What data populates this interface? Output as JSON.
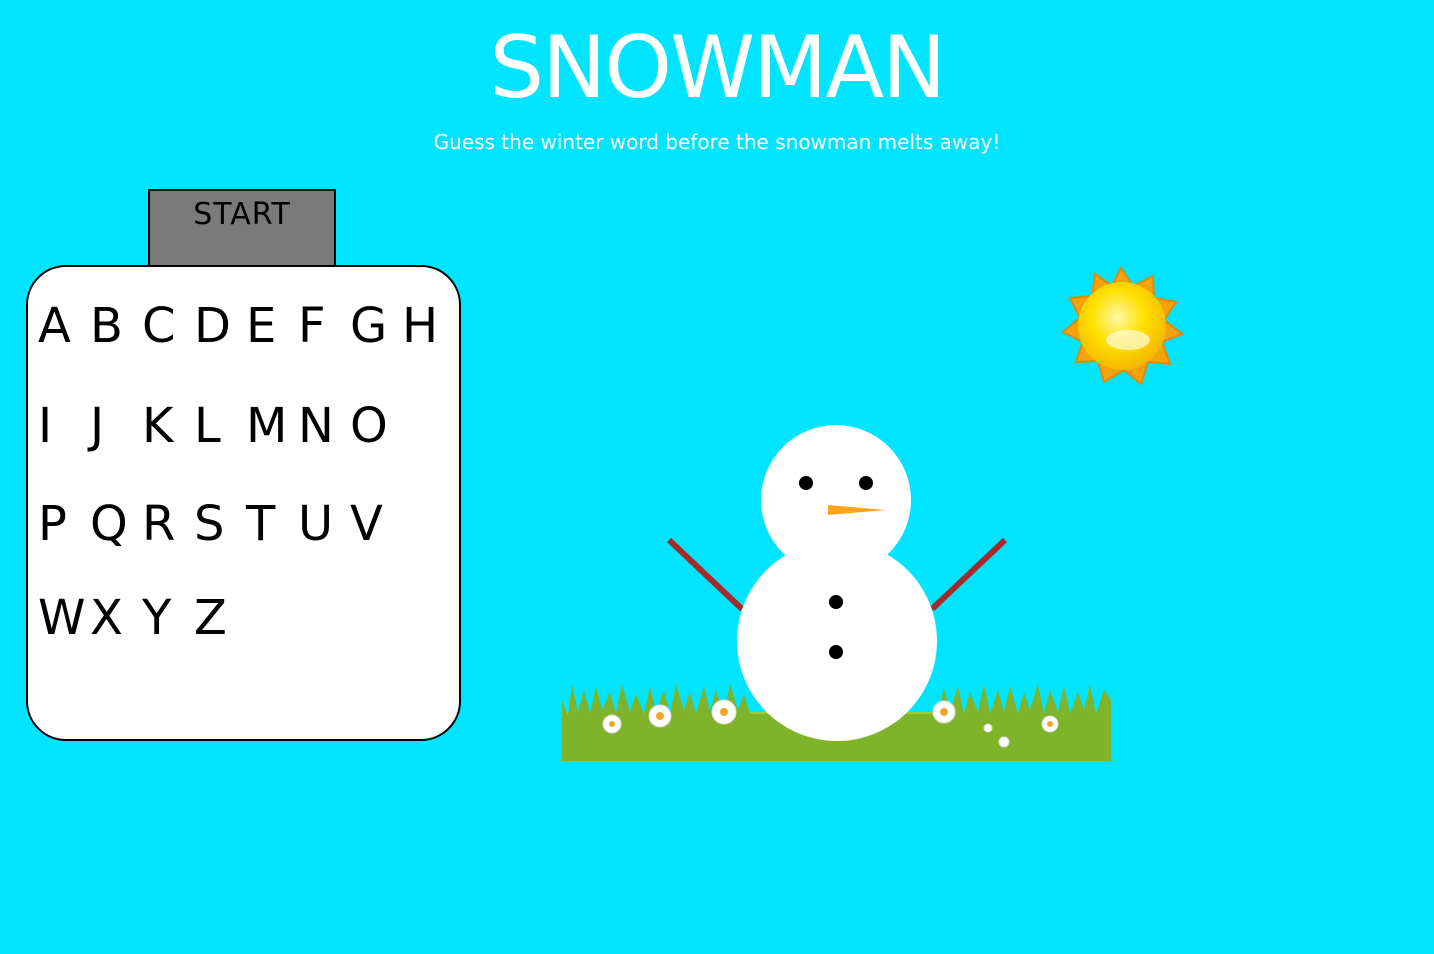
{
  "header": {
    "title": "SNOWMAN",
    "subtitle": "Guess the winter word before the snowman melts away!"
  },
  "controls": {
    "start_label": "START"
  },
  "alphabet": {
    "rows": [
      [
        "A",
        "B",
        "C",
        "D",
        "E",
        "F",
        "G",
        "H"
      ],
      [
        "I",
        "J",
        "K",
        "L",
        "M",
        "N",
        "O"
      ],
      [
        "P",
        "Q",
        "R",
        "S",
        "T",
        "U",
        "V"
      ],
      [
        "W",
        "X",
        "Y",
        "Z"
      ]
    ]
  },
  "scene": {
    "sun_icon": "sun-icon",
    "grass_icon": "grass-with-daisies",
    "snowman_icon": "snowman"
  },
  "colors": {
    "background": "#00e5ff",
    "title": "#ffffff",
    "start_button": "#7a7a7a",
    "arm": "#a52a2a",
    "carrot": "#ffa31a",
    "sun": "#ffd700"
  }
}
